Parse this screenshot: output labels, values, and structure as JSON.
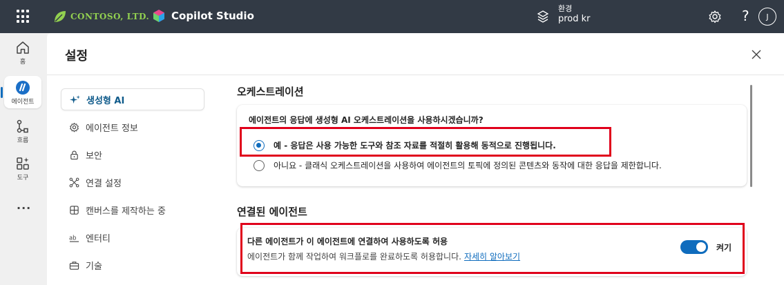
{
  "topbar": {
    "brand": "CONTOSO, LTD.",
    "product": "Copilot Studio",
    "environment_label": "환경",
    "environment_value": "prod kr",
    "help": "?",
    "avatar_initial": "J"
  },
  "rail": {
    "items": [
      {
        "label": "홈",
        "icon": "home-icon"
      },
      {
        "label": "에이전트",
        "icon": "agent-icon",
        "active": true
      },
      {
        "label": "흐름",
        "icon": "flow-icon"
      },
      {
        "label": "도구",
        "icon": "tools-icon"
      }
    ],
    "more": "···"
  },
  "page": {
    "title": "설정"
  },
  "settings_nav": {
    "items": [
      {
        "label": "생성형 AI",
        "icon": "sparkle-icon",
        "active": true
      },
      {
        "label": "에이전트 정보",
        "icon": "gear-icon"
      },
      {
        "label": "보안",
        "icon": "lock-icon"
      },
      {
        "label": "연결 설정",
        "icon": "connection-icon"
      },
      {
        "label": "캔버스를 제작하는 중",
        "icon": "canvas-icon"
      },
      {
        "label": "엔터티",
        "icon": "entity-icon"
      },
      {
        "label": "기술",
        "icon": "briefcase-icon"
      }
    ]
  },
  "orchestration": {
    "title": "오케스트레이션",
    "question": "에이전트의 응답에 생성형 AI 오케스트레이션을 사용하시겠습니까?",
    "options": [
      {
        "label": "예 - 응답은 사용 가능한 도구와 참조 자료를 적절히 활용해 동적으로 진행됩니다.",
        "selected": true
      },
      {
        "label": "아니요 - 클래식 오케스트레이션을 사용하여 에이전트의 토픽에 정의된 콘텐츠와 동작에 대한 응답을 제한합니다.",
        "selected": false
      }
    ]
  },
  "connected_agents": {
    "title": "연결된 에이전트",
    "permission_title": "다른 에이전트가 이 에이전트에 연결하여 사용하도록 허용",
    "permission_desc": "에이전트가 함께 작업하여 워크플로를 완료하도록 허용합니다.",
    "learn_more": "자세히 알아보기",
    "toggle_state": "켜기",
    "toggle_on": true
  },
  "colors": {
    "topbar_bg": "#323a45",
    "accent": "#0f6cbd",
    "highlight": "#e0001b",
    "brand_green": "#92d050"
  }
}
